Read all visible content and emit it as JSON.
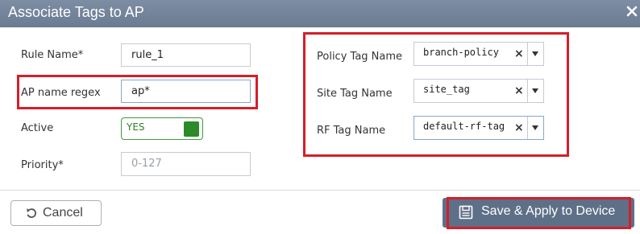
{
  "dialog": {
    "title": "Associate Tags to AP",
    "close_icon": "close-icon"
  },
  "form": {
    "rule_name": {
      "label": "Rule Name*",
      "value": "rule_1"
    },
    "ap_name_regex": {
      "label": "AP name regex",
      "value": "ap*"
    },
    "active": {
      "label": "Active",
      "toggle_text": "YES",
      "state": "on"
    },
    "priority": {
      "label": "Priority*",
      "placeholder": "0-127"
    }
  },
  "tags": {
    "policy": {
      "label": "Policy Tag Name",
      "value": "branch-policy"
    },
    "site": {
      "label": "Site Tag Name",
      "value": "site_tag"
    },
    "rf": {
      "label": "RF Tag Name",
      "value": "default-rf-tag"
    }
  },
  "footer": {
    "cancel_label": "Cancel",
    "save_label": "Save & Apply to Device"
  },
  "colors": {
    "header_bg": "#6f8097",
    "highlight_red": "#d41f2a",
    "toggle_green": "#2c8a29",
    "save_bg": "#5e7087"
  }
}
